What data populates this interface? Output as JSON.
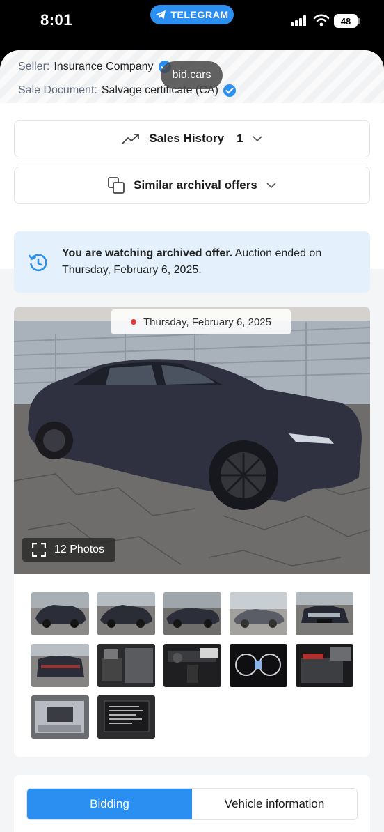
{
  "status_bar": {
    "time": "8:01",
    "telegram_label": "TELEGRAM",
    "battery": "48"
  },
  "seller": {
    "seller_label": "Seller:",
    "seller_value": "Insurance Company",
    "document_label": "Sale Document:",
    "document_value": "Salvage certificate (CA)",
    "tooltip": "bid.cars"
  },
  "sales_history": {
    "label": "Sales History",
    "count": "1",
    "icon": "trending-up-icon"
  },
  "similar_offers": {
    "label": "Similar archival offers",
    "icon": "copy-icon"
  },
  "notice": {
    "bold": "You are watching archived offer.",
    "rest": " Auction ended on Thursday, February 6, 2025.",
    "icon": "history-icon"
  },
  "gallery": {
    "date": "Thursday, February 6, 2025",
    "photos_label": "12 Photos",
    "thumbnail_count": 12
  },
  "tabs": [
    {
      "label": "Bidding",
      "active": true
    },
    {
      "label": "Vehicle information",
      "active": false
    }
  ],
  "colors": {
    "accent": "#2a8ff0",
    "notice_bg": "#e4f1fc",
    "live_dot": "#e5383b"
  }
}
